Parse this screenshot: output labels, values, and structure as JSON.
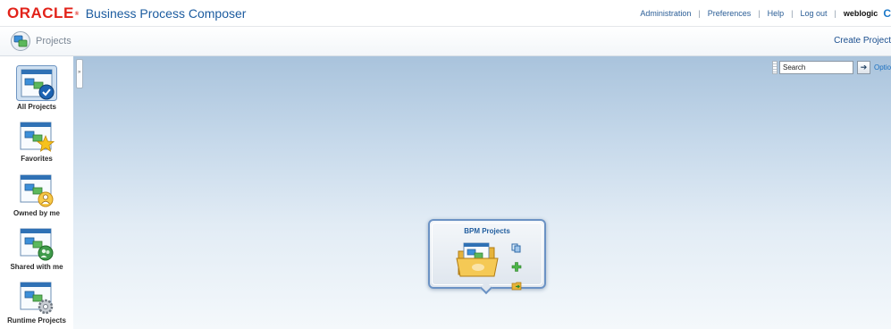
{
  "header": {
    "brand": "ORACLE",
    "app_title": "Business Process Composer",
    "links": {
      "administration": "Administration",
      "preferences": "Preferences",
      "help": "Help",
      "logout": "Log out"
    },
    "separator": "|",
    "user": "weblogic",
    "more": "C"
  },
  "subheader": {
    "crumb": "Projects",
    "create_project": "Create Project"
  },
  "sidebar": {
    "items": [
      {
        "label": "All Projects",
        "icon": "project-check-icon",
        "selected": true
      },
      {
        "label": "Favorites",
        "icon": "project-star-icon"
      },
      {
        "label": "Owned by me",
        "icon": "project-user-icon"
      },
      {
        "label": "Shared with me",
        "icon": "project-shared-icon"
      },
      {
        "label": "Runtime Projects",
        "icon": "project-gear-icon"
      }
    ]
  },
  "search": {
    "placeholder": "Search",
    "options": "Options"
  },
  "card": {
    "title": "BPM Projects",
    "actions": [
      "copy-icon",
      "add-icon",
      "import-icon"
    ]
  },
  "colors": {
    "oracle_red": "#e2231a",
    "title_blue": "#1b5b9f",
    "link_blue": "#2a5d96"
  }
}
